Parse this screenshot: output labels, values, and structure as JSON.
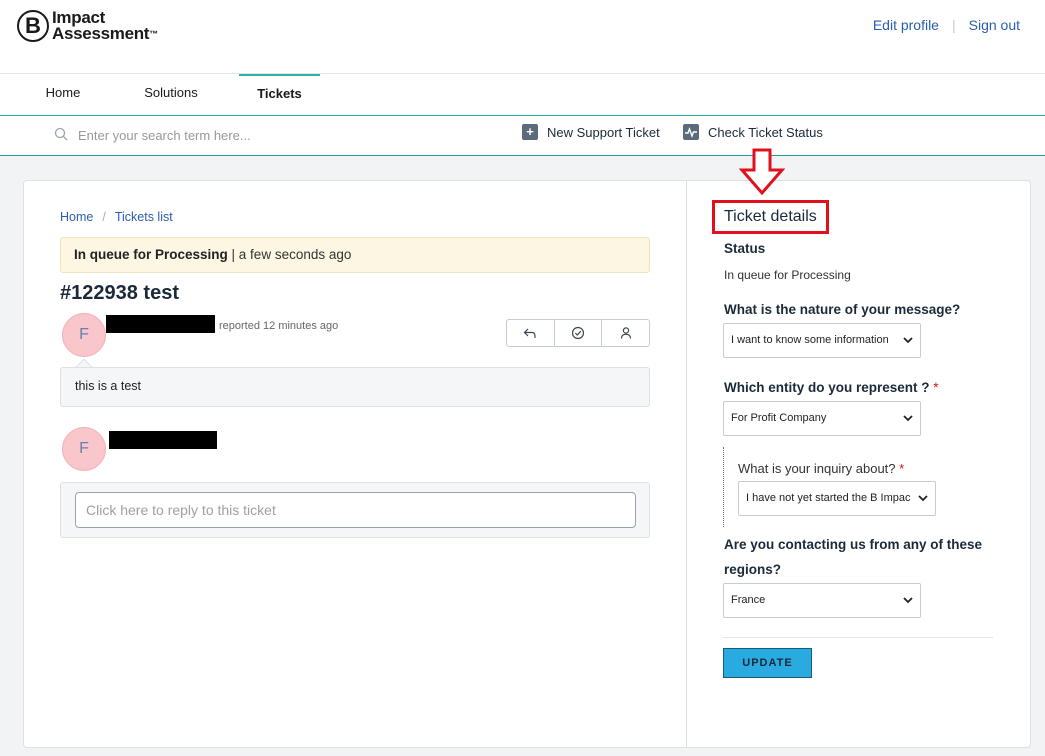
{
  "brand": {
    "logo_letter": "B",
    "name_line1": "Impact",
    "name_line2": "Assessment",
    "trademark": "™"
  },
  "top_links": {
    "edit_profile": "Edit profile",
    "separator": "|",
    "sign_out": "Sign out"
  },
  "nav": {
    "tabs": [
      {
        "label": "Home"
      },
      {
        "label": "Solutions"
      },
      {
        "label": "Tickets",
        "active": true
      }
    ]
  },
  "search": {
    "placeholder": "Enter your search term here..."
  },
  "actions": {
    "new_ticket": "New Support Ticket",
    "check_status": "Check Ticket Status"
  },
  "breadcrumb": {
    "home": "Home",
    "separator": "/",
    "list": "Tickets list"
  },
  "status_banner": {
    "state": "In queue for Processing",
    "separator": " | ",
    "time": "a few seconds ago"
  },
  "ticket": {
    "title": "#122938 test",
    "reported": "reported 12 minutes ago",
    "message": "this is a test",
    "avatar_initial": "F"
  },
  "reply": {
    "placeholder": "Click here to reply to this ticket"
  },
  "details": {
    "heading": "Ticket details",
    "status_label": "Status",
    "status_value": "In queue for Processing",
    "nature_label": "What is the nature of your message?",
    "nature_value": "I want to know some information",
    "entity_label": "Which entity do you represent ?",
    "entity_value": "For Profit Company",
    "inquiry_label": "What is your inquiry about?",
    "inquiry_value": "I have not yet started the B Impac",
    "regions_label_1": "Are you contacting us from any of these",
    "regions_label_2": "regions?",
    "regions_value": "France",
    "required_mark": "*",
    "update_label": "UPDATE"
  },
  "colors": {
    "accent_teal": "#2fb0b0",
    "link_blue": "#2a5db0",
    "highlight_red": "#e0101c",
    "update_blue": "#29abe2",
    "avatar_pink": "#f9c6cc"
  }
}
